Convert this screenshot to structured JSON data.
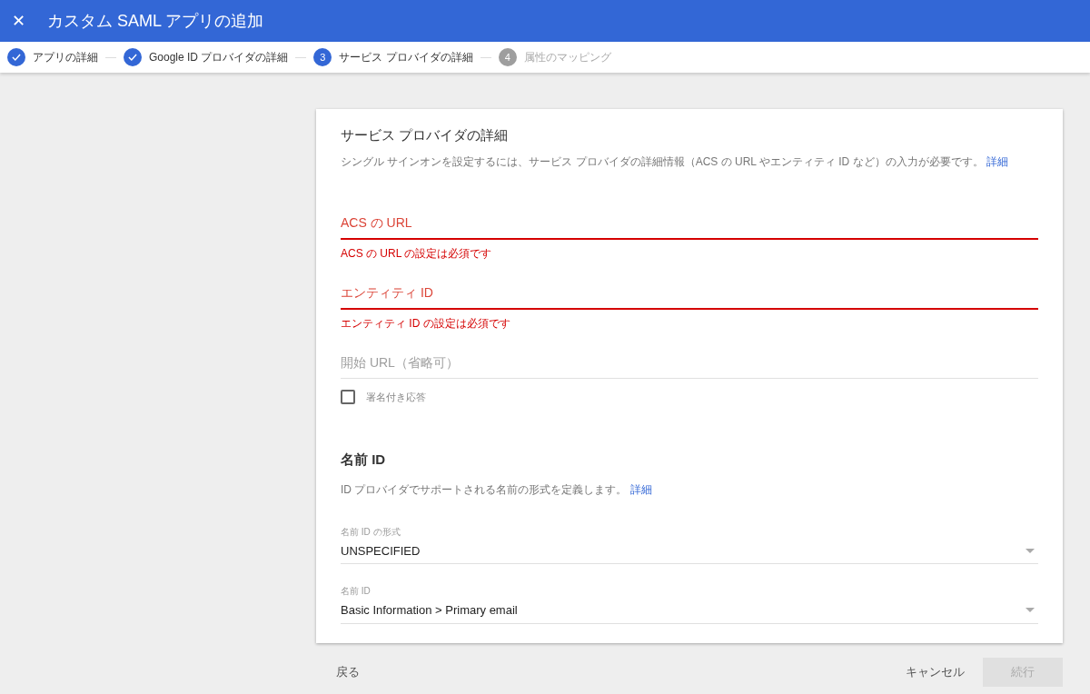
{
  "header": {
    "close": "✕",
    "title": "カスタム SAML アプリの追加"
  },
  "steps": [
    {
      "label": "アプリの詳細",
      "kind": "done"
    },
    {
      "label": "Google ID プロバイダの詳細",
      "kind": "done"
    },
    {
      "label": "サービス プロバイダの詳細",
      "kind": "current",
      "number": "3"
    },
    {
      "label": "属性のマッピング",
      "kind": "pending",
      "number": "4"
    }
  ],
  "section": {
    "title": "サービス プロバイダの詳細",
    "description": "シングル サインオンを設定するには、サービス プロバイダの詳細情報（ACS の URL やエンティティ ID など）の入力が必要です。",
    "link": "詳細"
  },
  "fields": [
    {
      "placeholder": "ACS の URL",
      "invalid": true,
      "error": "ACS の URL の設定は必須です"
    },
    {
      "placeholder": "エンティティ ID",
      "invalid": true,
      "error": "エンティティ ID の設定は必須です"
    },
    {
      "placeholder": "開始 URL（省略可）",
      "invalid": false
    }
  ],
  "signed_response": {
    "label": "署名付き応答",
    "checked": false
  },
  "name_id": {
    "title": "名前 ID",
    "description": "ID プロバイダでサポートされる名前の形式を定義します。",
    "link": "詳細"
  },
  "selects": [
    {
      "label": "名前 ID の形式",
      "value": "UNSPECIFIED"
    },
    {
      "label": "名前 ID",
      "value": "Basic Information > Primary email"
    }
  ],
  "footer": {
    "back": "戻る",
    "cancel": "キャンセル",
    "continue": {
      "label": "続行",
      "disabled": true
    }
  }
}
